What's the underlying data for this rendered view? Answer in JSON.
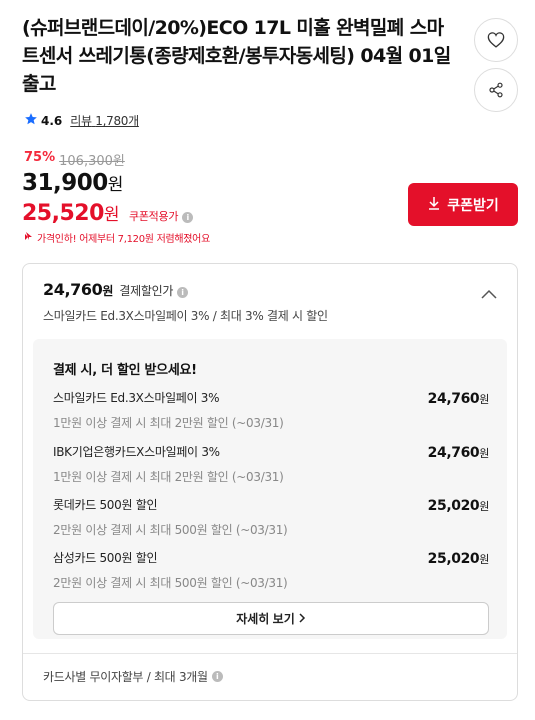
{
  "product": {
    "title": "(슈퍼브랜드데이/20%)ECO 17L 미홀 완벽밀폐 스마트센서 쓰레기통(종량제호환/봉투자동세팅) 04월 01일 출고",
    "rating": "4.6",
    "review_label": "리뷰",
    "review_count": "1,780개"
  },
  "actions": {
    "wishlist_icon": "heart-icon",
    "share_icon": "share-icon"
  },
  "price": {
    "discount_rate": "75%",
    "original_price": "106,300원",
    "sale_price": "31,900",
    "won": "원",
    "coupon_price": "25,520",
    "coupon_label": "쿠폰적용가",
    "price_drop_note": "가격인하! 어제부터 7,120원 저렴해졌어요",
    "coupon_button": "쿠폰받기"
  },
  "payment": {
    "amount": "24,760",
    "won": "원",
    "label": "결제할인가",
    "subtitle": "스마일카드 Ed.3X스마일페이 3% / 최대 3% 결제 시 할인",
    "panel_title": "결제 시, 더 할인 받으세요!",
    "offers": [
      {
        "name": "스마일카드 Ed.3X스마일페이 3%",
        "condition": "1만원 이상 결제 시 최대 2만원 할인 (~03/31)",
        "value": "24,760"
      },
      {
        "name": "IBK기업은행카드X스마일페이 3%",
        "condition": "1만원 이상 결제 시 최대 2만원 할인 (~03/31)",
        "value": "24,760"
      },
      {
        "name": "롯데카드 500원 할인",
        "condition": "2만원 이상 결제 시 최대 500원 할인 (~03/31)",
        "value": "25,020"
      },
      {
        "name": "삼성카드 500원 할인",
        "condition": "2만원 이상 결제 시 최대 500원 할인 (~03/31)",
        "value": "25,020"
      }
    ],
    "detail_button": "자세히 보기",
    "installment_note": "카드사별 무이자할부 / 최대 3개월"
  },
  "colors": {
    "accent_red": "#e4102a",
    "star_blue": "#1a6dff"
  }
}
